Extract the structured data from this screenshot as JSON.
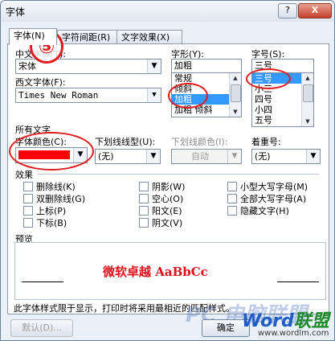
{
  "window": {
    "title": "字体",
    "help_label": "?",
    "close_label": "X"
  },
  "tabs": [
    "字体(N)",
    "字符间距(R)",
    "文字效果(X)"
  ],
  "badge": "⑤",
  "fields": {
    "cn_font_label": "中文字体(T):",
    "cn_font_value": "宋体",
    "western_font_label": "西文字体(F):",
    "western_font_value": "Times New Roman",
    "style_label": "字形(Y):",
    "style_value": "加粗",
    "style_items": [
      "常规",
      "倾斜",
      "加粗",
      "加粗 倾斜"
    ],
    "size_label": "字号(S):",
    "size_value": "三号",
    "size_items": [
      "三号",
      "小三",
      "四号",
      "小四",
      "五号"
    ]
  },
  "all_text": {
    "group_label": "所有文字",
    "color_label": "字体颜色(C):",
    "color_value": "#ff0000",
    "underline_label": "下划线线型(U):",
    "underline_value": "(无)",
    "underline_color_label": "下划线颜色(I):",
    "underline_color_value": "自动",
    "emphasis_label": "着重号:",
    "emphasis_value": "(无)"
  },
  "effects": {
    "label": "效果",
    "col1": [
      "删除线(K)",
      "双删除线(G)",
      "上标(P)",
      "下标(B)"
    ],
    "col2": [
      "阴影(W)",
      "空心(O)",
      "阳文(E)",
      "阴文(V)"
    ],
    "col3": [
      "小型大写字母(M)",
      "全部大写字母(A)",
      "隐藏文字(H)"
    ]
  },
  "preview": {
    "label": "预览",
    "text": "微软卓越 AaBbCc"
  },
  "info_text": "此字体样式限于显示，打印时将采用最相近的匹配样式。",
  "buttons": {
    "default": "默认(D)...",
    "ok": "确定"
  },
  "watermark": {
    "big": "PC 电脑联盟",
    "logo_word": "Word",
    "logo_suffix": "联盟",
    "url": "www.wordlm.com"
  }
}
